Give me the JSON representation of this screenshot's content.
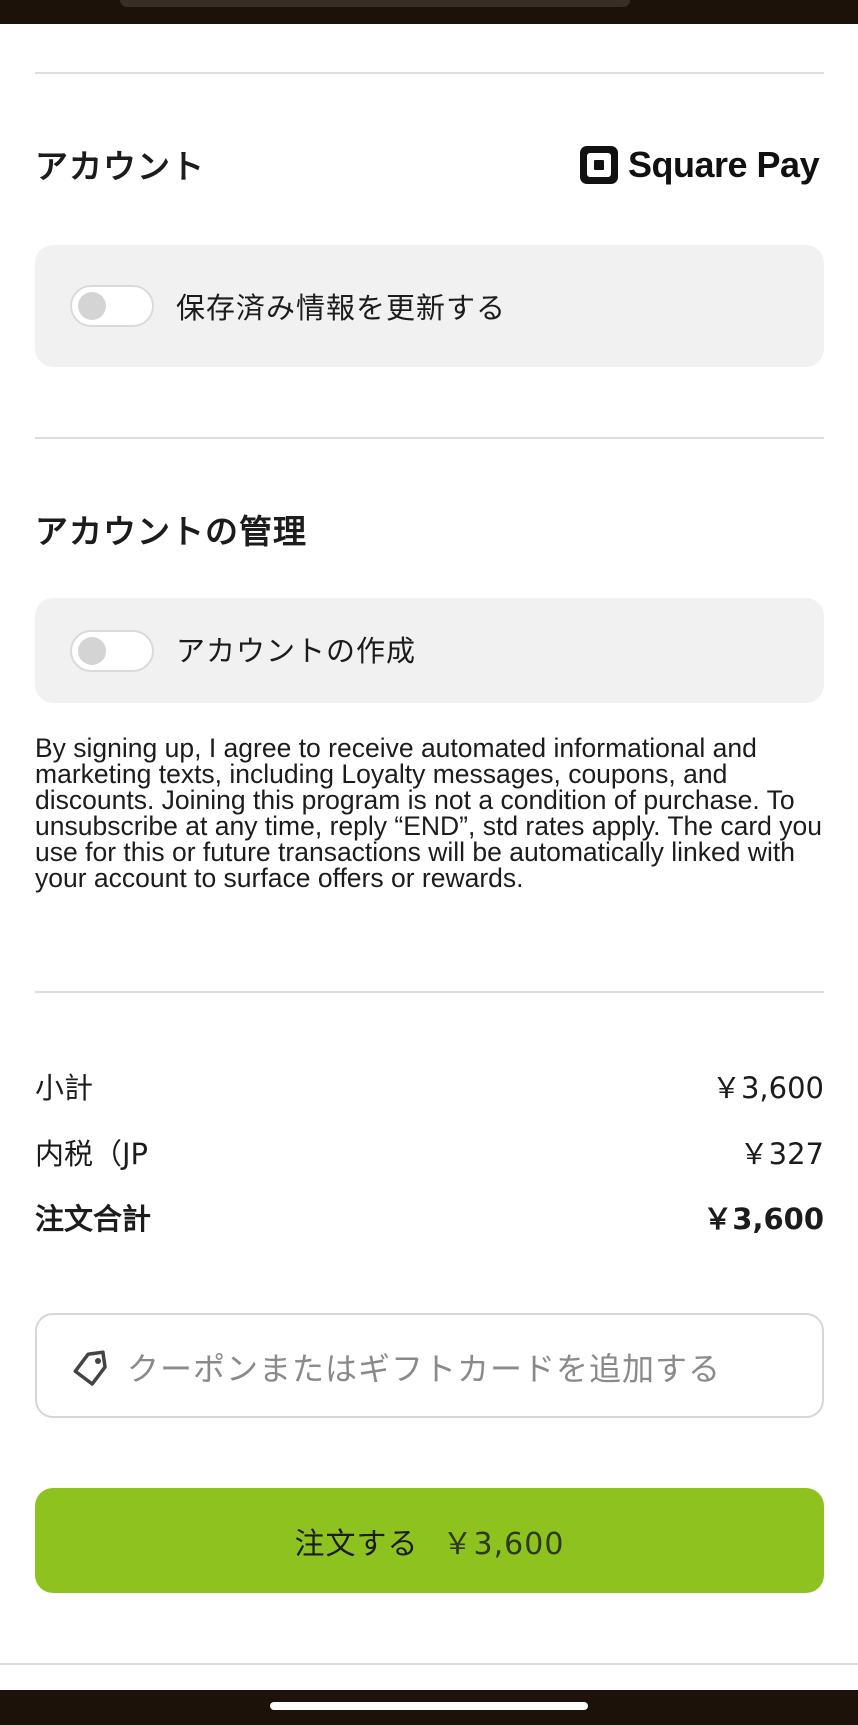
{
  "account": {
    "title": "アカウント",
    "brand": "Square Pay",
    "update_saved_label": "保存済み情報を更新する"
  },
  "account_management": {
    "title": "アカウントの管理",
    "create_account_label": "アカウントの作成",
    "disclaimer": "By signing up, I agree to receive automated informational and marketing texts, including Loyalty messages, coupons, and discounts. Joining this program is not a condition of purchase. To unsubscribe at any time, reply “END”, std rates apply. The card you use for this or future transactions will be automatically linked with your account to surface offers or rewards."
  },
  "summary": {
    "subtotal_label": "小計",
    "subtotal_value": "￥3,600",
    "tax_label": "内税（JP",
    "tax_value": "￥327",
    "total_label": "注文合計",
    "total_value": "￥3,600"
  },
  "coupon": {
    "placeholder": "クーポンまたはギフトカードを追加する"
  },
  "order_button": {
    "label": "注文する",
    "price": "￥3,600"
  },
  "toggles": {
    "update_saved_on": false,
    "create_account_on": false
  },
  "colors": {
    "accent_green": "#8dc21f",
    "card_background": "#f1f1f1",
    "divider": "#dedede"
  },
  "icons": {
    "brand": "square-logo-icon",
    "coupon": "tag-icon"
  }
}
